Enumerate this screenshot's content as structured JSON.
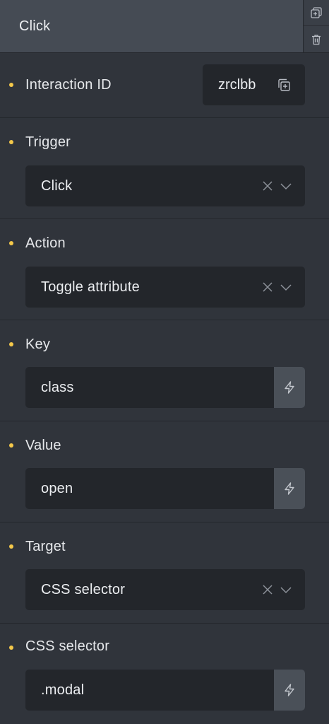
{
  "header": {
    "title": "Click",
    "duplicate_icon": "duplicate-icon",
    "delete_icon": "trash-icon"
  },
  "fields": {
    "interaction_id": {
      "label": "Interaction ID",
      "value": "zrclbb",
      "icon": "copy-icon"
    },
    "trigger": {
      "label": "Trigger",
      "value": "Click"
    },
    "action": {
      "label": "Action",
      "value": "Toggle attribute"
    },
    "key": {
      "label": "Key",
      "value": "class",
      "icon": "dynamic-data-icon"
    },
    "value": {
      "label": "Value",
      "value": "open",
      "icon": "dynamic-data-icon"
    },
    "target": {
      "label": "Target",
      "value": "CSS selector"
    },
    "css_selector": {
      "label": "CSS selector",
      "value": ".modal",
      "icon": "dynamic-data-icon"
    }
  },
  "colors": {
    "background": "#30343b",
    "header": "#454b54",
    "control": "#23262b",
    "indicator_dot": "#f4c84a",
    "dynamic_button": "#4a5058"
  }
}
